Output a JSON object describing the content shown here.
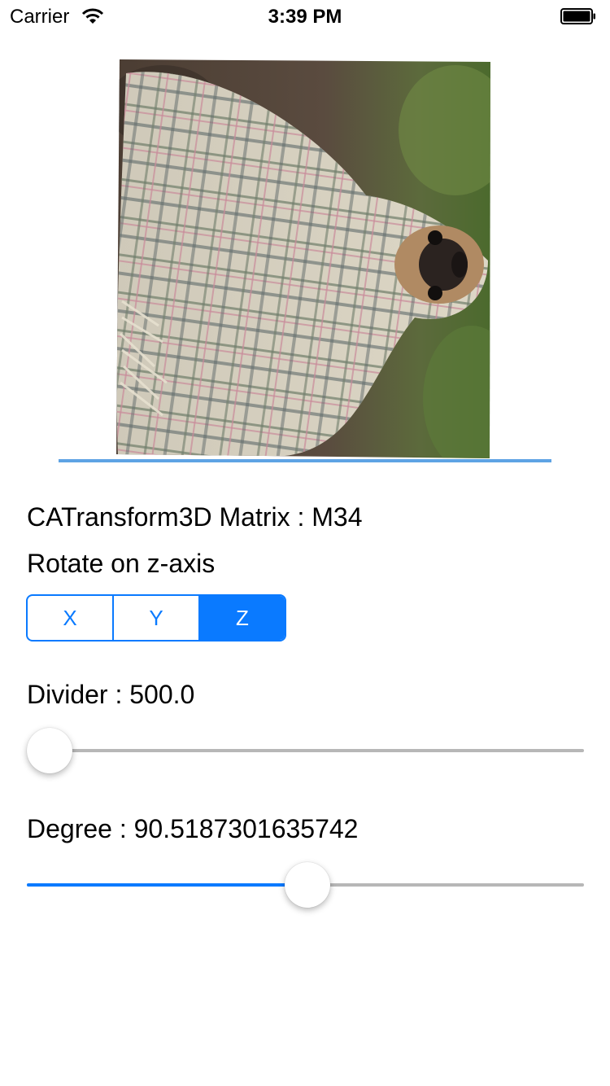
{
  "status_bar": {
    "carrier": "Carrier",
    "time": "3:39 PM"
  },
  "image": {
    "subject": "pug-wrapped-in-plaid-blanket"
  },
  "matrix_title": "CATransform3D Matrix : M34",
  "rotate_label": "Rotate on z-axis",
  "axis_segments": {
    "options": [
      "X",
      "Y",
      "Z"
    ],
    "selected": "Z"
  },
  "divider": {
    "label": "Divider : 500.0",
    "value_fraction": 0.0
  },
  "degree": {
    "label": "Degree : 90.5187301635742",
    "value_fraction": 0.504
  },
  "colors": {
    "accent": "#0a7aff",
    "track": "#b7b7b7",
    "image_underline": "#5ea3e4"
  }
}
